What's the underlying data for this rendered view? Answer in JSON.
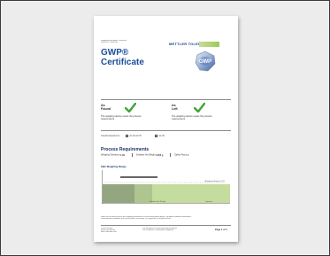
{
  "document": {
    "header_line_1": "Weighing Instruments Certificate",
    "header_line_2": "Device ID · Serial No.",
    "logo_text": "METTLER TOLEDO",
    "title_line_1": "GWP®",
    "title_line_2": "Certificate",
    "seal_text": "GWP",
    "as_found": {
      "heading_1": "As",
      "heading_2": "Found",
      "text": "The weighing device meets the process requirements"
    },
    "as_left": {
      "heading_1": "As",
      "heading_2": "Left",
      "text": "The weighing device meets the process requirements"
    },
    "assessment_label": "Overall assessment",
    "option_1": "As found OK",
    "option_2": "As left",
    "process_title": "Process Requirements",
    "req_1_label": "Weighing Tolerance",
    "req_1_value": "0.1%",
    "req_2_label": "Smallest Net Weight",
    "req_2_value": "0.000 g",
    "req_3_label": "Safety Factor",
    "req_3_value": "2",
    "range_title": "Safe Weighing Range",
    "chart_note": "Weighing Tolerance 0.1%",
    "chart_lower_label": "Smallest Net Weight",
    "chart_upper_label": "Capacity",
    "notes_1": "Notes on the results and on the weighing performance of the measurement device, including calibration information,",
    "notes_2": "environmental conditions and measurement uncertainty; see appendix for detailed values.",
    "footer_left_1": "Certificate date",
    "footer_left_2": "Service technician",
    "footer_left_3": "Next calibration due",
    "footer_mid_1": "The document was electronically generated.",
    "footer_mid_2": "This certificate is valid without signature.",
    "page_label": "Page 1 of 4"
  },
  "colors": {
    "title_blue": "#1c4d9a",
    "check_green": "#3fa535",
    "logo_green": "#9ec95a",
    "range_green": "#c4dc9d"
  }
}
